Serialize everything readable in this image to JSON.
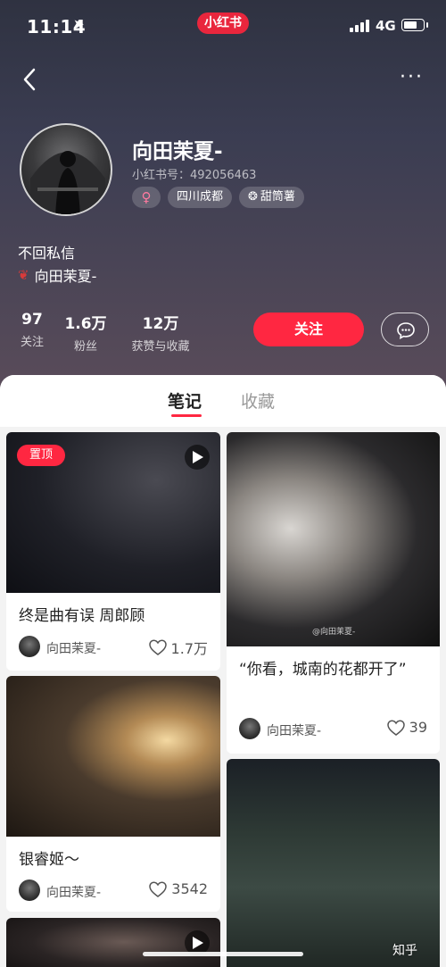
{
  "status_bar": {
    "time": "11:14",
    "network": "4G",
    "app_badge": "小红书"
  },
  "header": {
    "more_label": "···"
  },
  "profile": {
    "name": "向田茉夏-",
    "id_label": "小红书号：492056463",
    "tags": {
      "gender": "♀",
      "location": "四川成都",
      "level": "甜筒薯"
    },
    "bio_line1": "不回私信",
    "bio_line2": "向田茉夏-",
    "stats": [
      {
        "value": "97",
        "label": "关注"
      },
      {
        "value": "1.6万",
        "label": "粉丝"
      },
      {
        "value": "12万",
        "label": "获赞与收藏"
      }
    ],
    "follow_label": "关注"
  },
  "tabs": [
    {
      "label": "笔记",
      "active": true
    },
    {
      "label": "收藏",
      "active": false
    }
  ],
  "notes": [
    {
      "title": "终是曲有误 周郎顾",
      "author": "向田茉夏-",
      "likes": "1.7万",
      "pinned_label": "置顶",
      "video": true
    },
    {
      "title": "“你看，城南的花都开了”",
      "author": "向田茉夏-",
      "likes": "39",
      "video": false,
      "watermark": "@向田茉夏-"
    },
    {
      "title": "银睿姬～",
      "author": "向田茉夏-",
      "likes": "3542",
      "video": false
    },
    {
      "title": "",
      "author": "",
      "likes": "",
      "video": false
    },
    {
      "title": "",
      "author": "",
      "likes": "",
      "video": true
    }
  ],
  "overlay": {
    "zhihu_watermark": "知乎"
  },
  "colors": {
    "accent": "#ff2741",
    "header_top": "#2f3241",
    "header_bottom": "#5a4c5a"
  }
}
